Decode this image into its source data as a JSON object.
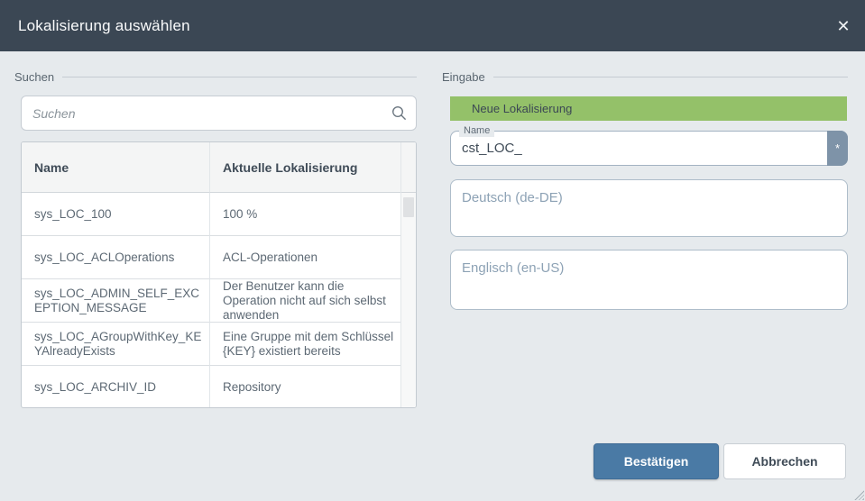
{
  "dialog": {
    "title": "Lokalisierung auswählen",
    "close_glyph": "✕"
  },
  "search_section": {
    "label": "Suchen",
    "search_placeholder": "Suchen",
    "table": {
      "columns": [
        "Name",
        "Aktuelle Lokalisierung"
      ],
      "rows": [
        {
          "name": "sys_LOC_100",
          "localization": "100 %"
        },
        {
          "name": "sys_LOC_ACLOperations",
          "localization": "ACL-Operationen"
        },
        {
          "name": "sys_LOC_ADMIN_SELF_EXCEPTION_MESSAGE",
          "localization": "Der Benutzer kann die Operation nicht auf sich selbst anwenden"
        },
        {
          "name": "sys_LOC_AGroupWithKey_KEYAlreadyExists",
          "localization": "Eine Gruppe mit dem Schlüssel {KEY} existiert bereits"
        },
        {
          "name": "sys_LOC_ARCHIV_ID",
          "localization": "Repository"
        }
      ]
    }
  },
  "input_section": {
    "label": "Eingabe",
    "banner": "Neue Lokalisierung",
    "name_field": {
      "label": "Name",
      "value": "cst_LOC_",
      "required_marker": "*"
    },
    "german_field": {
      "placeholder": "Deutsch (de-DE)"
    },
    "english_field": {
      "placeholder": "Englisch (en-US)"
    }
  },
  "footer": {
    "confirm_label": "Bestätigen",
    "cancel_label": "Abbrechen"
  },
  "colors": {
    "header_bg": "#3b4754",
    "background": "#e6eaed",
    "banner_green": "#94c169",
    "confirm_blue": "#4a7aa5"
  }
}
